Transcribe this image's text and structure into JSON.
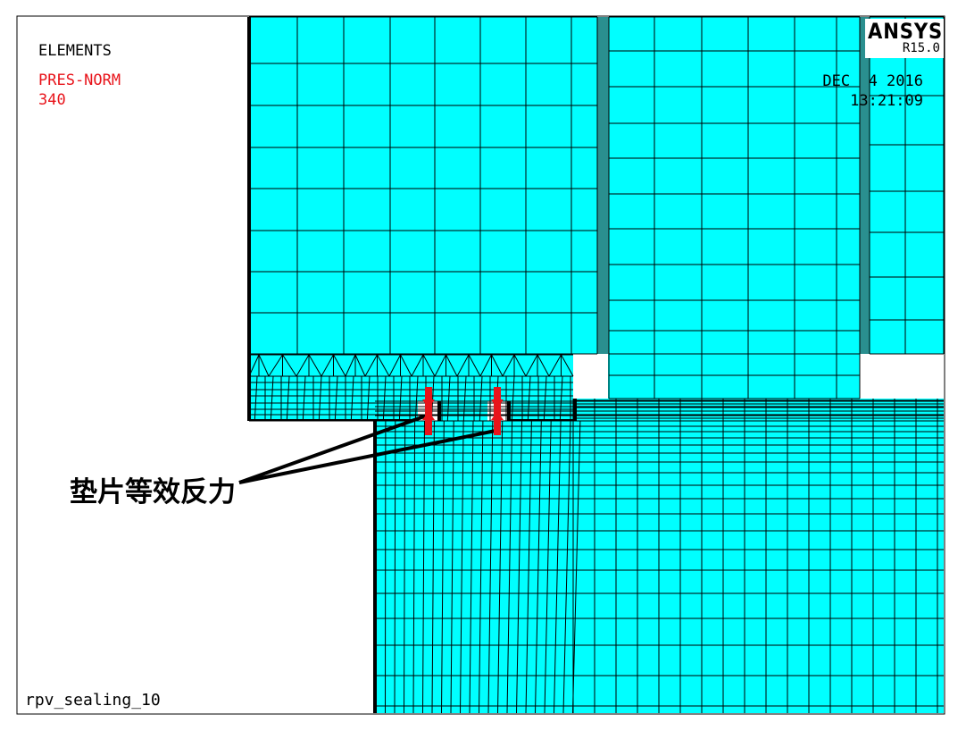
{
  "plot_label": "ELEMENTS",
  "surface_load": {
    "label": "PRES-NORM",
    "value": "340"
  },
  "timestamp": {
    "date": "DEC  4 2016",
    "time": "13:21:09"
  },
  "logo": {
    "name": "ANSYS",
    "version": "R15.0"
  },
  "jobname": "rpv_sealing_10",
  "annotation": "垫片等效反力",
  "colors": {
    "mesh_fill": "#00ffff",
    "mesh_line": "#000000",
    "pressure_arrow": "#e8141b",
    "thick_element": "#2a8f8f"
  }
}
